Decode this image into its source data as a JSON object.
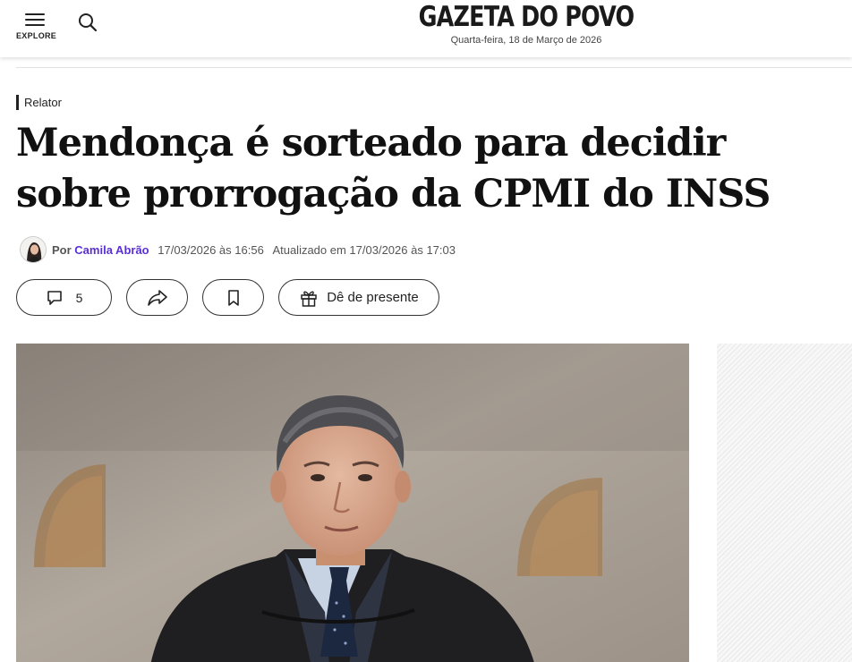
{
  "header": {
    "menu_label": "EXPLORE",
    "logo_text": "GAZETA DO POVO",
    "date_text": "Quarta-feira, 18 de Março de 2026"
  },
  "article": {
    "kicker": "Relator",
    "headline": "Mendonça é sorteado para decidir sobre prorrogação da CPMI do INSS",
    "byline": {
      "prefix": "Por",
      "author": "Camila Abrão",
      "published": "17/03/2026 às 16:56",
      "updated": "Atualizado em 17/03/2026 às 17:03"
    },
    "actions": {
      "comments_count": "5",
      "gift_label": "Dê de presente"
    }
  },
  "icons": {
    "menu": "hamburger-menu-icon",
    "search": "search-icon",
    "comment": "comment-icon",
    "share": "share-icon",
    "bookmark": "bookmark-icon",
    "gift": "gift-icon"
  },
  "colors": {
    "author_link": "#5a2fd6",
    "text": "#111111"
  }
}
